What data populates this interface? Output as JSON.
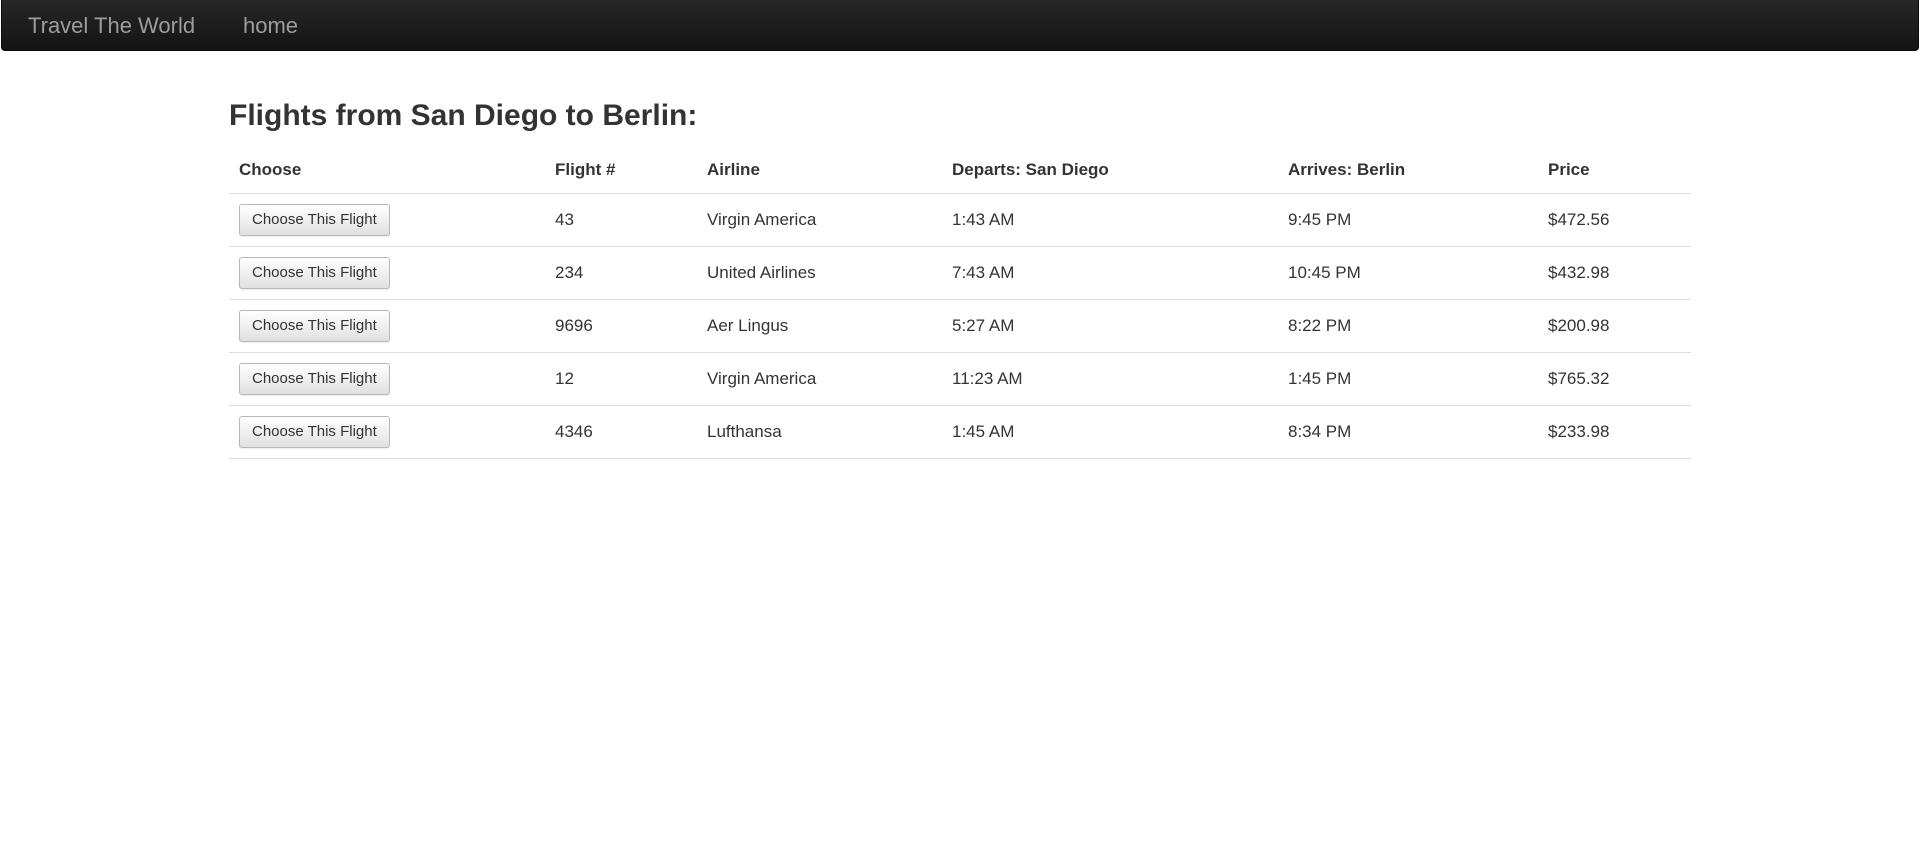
{
  "navbar": {
    "brand": "Travel The World",
    "home_link": "home"
  },
  "page": {
    "title": "Flights from San Diego to Berlin:"
  },
  "table": {
    "headers": {
      "choose": "Choose",
      "flight": "Flight #",
      "airline": "Airline",
      "departs": "Departs: San Diego",
      "arrives": "Arrives: Berlin",
      "price": "Price"
    },
    "button_label": "Choose This Flight",
    "rows": [
      {
        "flight": "43",
        "airline": "Virgin America",
        "departs": "1:43 AM",
        "arrives": "9:45 PM",
        "price": "$472.56"
      },
      {
        "flight": "234",
        "airline": "United Airlines",
        "departs": "7:43 AM",
        "arrives": "10:45 PM",
        "price": "$432.98"
      },
      {
        "flight": "9696",
        "airline": "Aer Lingus",
        "departs": "5:27 AM",
        "arrives": "8:22 PM",
        "price": "$200.98"
      },
      {
        "flight": "12",
        "airline": "Virgin America",
        "departs": "11:23 AM",
        "arrives": "1:45 PM",
        "price": "$765.32"
      },
      {
        "flight": "4346",
        "airline": "Lufthansa",
        "departs": "1:45 AM",
        "arrives": "8:34 PM",
        "price": "$233.98"
      }
    ]
  }
}
